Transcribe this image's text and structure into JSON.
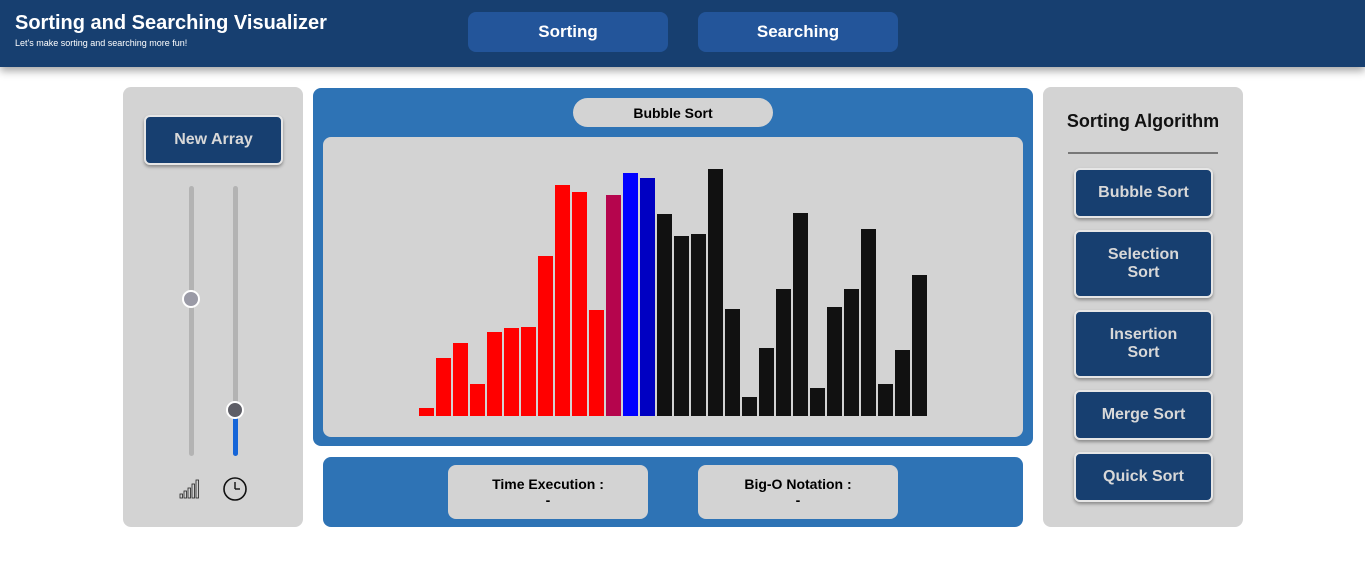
{
  "header": {
    "title": "Sorting and Searching Visualizer",
    "subtitle": "Let's make sorting and searching more fun!",
    "nav": [
      {
        "label": "Sorting"
      },
      {
        "label": "Searching"
      }
    ]
  },
  "controls": {
    "new_array_label": "New Array",
    "size_slider_level": 0.58,
    "speed_slider_level": 0.17,
    "size_icon": "signal-bars-icon",
    "speed_icon": "clock-icon"
  },
  "visualizer": {
    "current_algorithm": "Bubble Sort"
  },
  "chart_data": {
    "type": "bar",
    "values": [
      8,
      58,
      73,
      32,
      84,
      88,
      89,
      160,
      231,
      224,
      106,
      221,
      243,
      238,
      202,
      180,
      182,
      247,
      107,
      19,
      68,
      127,
      203,
      28,
      109,
      127,
      187,
      32,
      66,
      141
    ],
    "bar_colors": [
      "#ff0000",
      "#ff0000",
      "#ff0000",
      "#ff0000",
      "#ff0000",
      "#ff0000",
      "#ff0000",
      "#ff0000",
      "#ff0000",
      "#ff0000",
      "#ff0000",
      "#b5054d",
      "#0000ff",
      "#0000c2",
      "#111111",
      "#111111",
      "#111111",
      "#111111",
      "#111111",
      "#111111",
      "#111111",
      "#111111",
      "#111111",
      "#111111",
      "#111111",
      "#111111",
      "#111111",
      "#111111",
      "#111111",
      "#111111"
    ],
    "ylim": [
      0,
      260
    ]
  },
  "stats": {
    "time_label": "Time Execution :",
    "time_value": "-",
    "bigo_label": "Big-O Notation :",
    "bigo_value": "-"
  },
  "algorithms": {
    "title": "Sorting Algorithm",
    "items": [
      {
        "label": "Bubble Sort"
      },
      {
        "label": "Selection Sort"
      },
      {
        "label": "Insertion Sort"
      },
      {
        "label": "Merge Sort"
      },
      {
        "label": "Quick Sort"
      }
    ]
  }
}
